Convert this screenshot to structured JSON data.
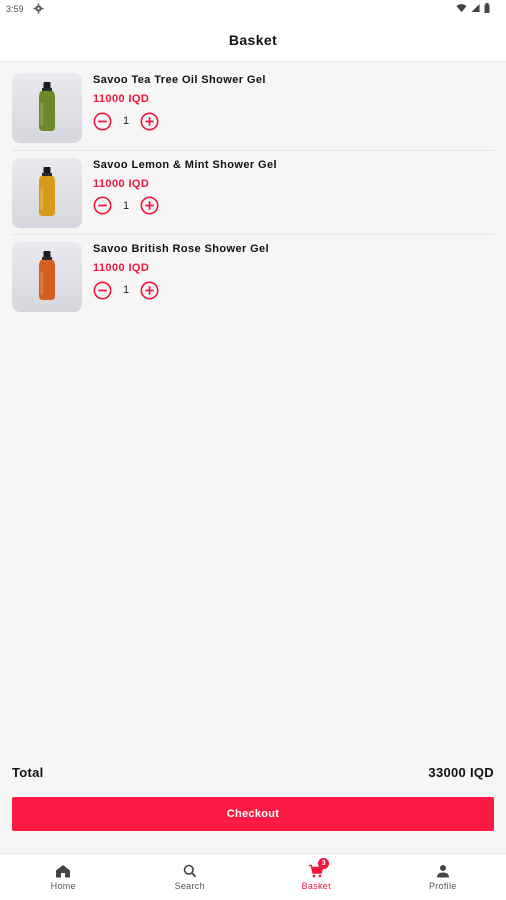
{
  "status_bar": {
    "time": "3:59",
    "icons": [
      "settings-gear-icon",
      "wifi-icon",
      "signal-icon",
      "battery-icon"
    ]
  },
  "app_bar": {
    "title": "Basket"
  },
  "basket": {
    "items": [
      {
        "name": "Savoo Tea Tree Oil Shower Gel",
        "price": "11000 IQD",
        "quantity": "1",
        "bottle_color": "#6c8a2a"
      },
      {
        "name": "Savoo Lemon & Mint Shower Gel",
        "price": "11000 IQD",
        "quantity": "1",
        "bottle_color": "#d89a17"
      },
      {
        "name": "Savoo British Rose Shower Gel",
        "price": "11000 IQD",
        "quantity": "1",
        "bottle_color": "#d2601e"
      }
    ]
  },
  "summary": {
    "total_label": "Total",
    "total_value": "33000 IQD"
  },
  "checkout": {
    "label": "Checkout"
  },
  "bottom_nav": {
    "items": [
      {
        "label": "Home",
        "icon": "home-icon",
        "active": false
      },
      {
        "label": "Search",
        "icon": "search-icon",
        "active": false
      },
      {
        "label": "Basket",
        "icon": "cart-icon",
        "active": true,
        "badge": "3"
      },
      {
        "label": "Profile",
        "icon": "person-icon",
        "active": false
      }
    ]
  },
  "colors": {
    "accent": "#f0163c",
    "checkout_button": "#fa1a44",
    "background": "#f6f6f6",
    "surface": "#ffffff"
  }
}
